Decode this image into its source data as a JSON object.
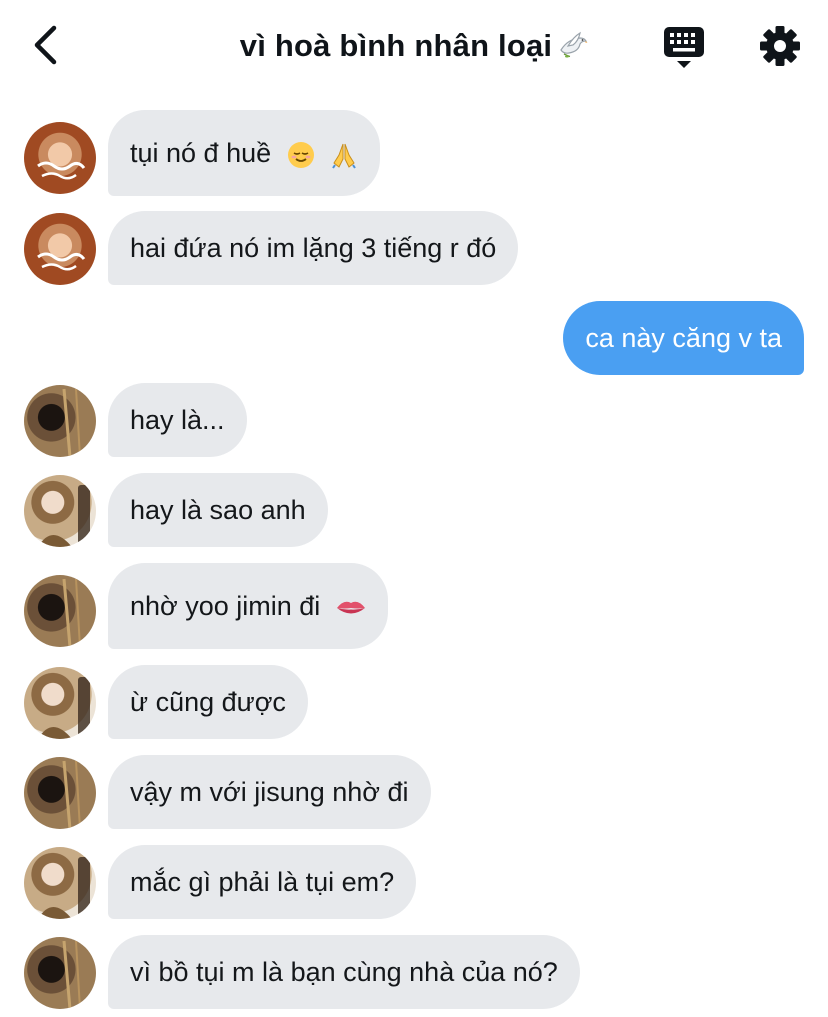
{
  "header": {
    "title": "vì hoà bình nhân loại",
    "title_icon": "dove-icon",
    "back_icon": "chevron-left-icon",
    "keyboard_icon": "keyboard-icon",
    "settings_icon": "gear-icon"
  },
  "colors": {
    "incoming_bubble": "#e7e9ec",
    "outgoing_bubble": "#4a9ff2",
    "text": "#14171a"
  },
  "messages": [
    {
      "text": "tụi nó đ huề",
      "direction": "incoming",
      "sender_avatar": "avatar-a",
      "emojis": [
        "relieved-face-emoji",
        "folded-hands-emoji"
      ]
    },
    {
      "text": "hai đứa nó im lặng 3 tiếng r đó",
      "direction": "incoming",
      "sender_avatar": "avatar-a"
    },
    {
      "text": "ca này căng v ta",
      "direction": "outgoing"
    },
    {
      "text": "hay là...",
      "direction": "incoming",
      "sender_avatar": "avatar-b"
    },
    {
      "text": "hay là sao anh",
      "direction": "incoming",
      "sender_avatar": "avatar-c"
    },
    {
      "text": "nhờ yoo jimin đi",
      "direction": "incoming",
      "sender_avatar": "avatar-b",
      "emojis": [
        "lips-emoji"
      ]
    },
    {
      "text": "ừ cũng được",
      "direction": "incoming",
      "sender_avatar": "avatar-c"
    },
    {
      "text": "vậy m với jisung nhờ đi",
      "direction": "incoming",
      "sender_avatar": "avatar-b"
    },
    {
      "text": "mắc gì phải là tụi em?",
      "direction": "incoming",
      "sender_avatar": "avatar-c"
    },
    {
      "text": "vì bồ tụi m là bạn cùng nhà của nó?",
      "direction": "incoming",
      "sender_avatar": "avatar-b"
    }
  ]
}
